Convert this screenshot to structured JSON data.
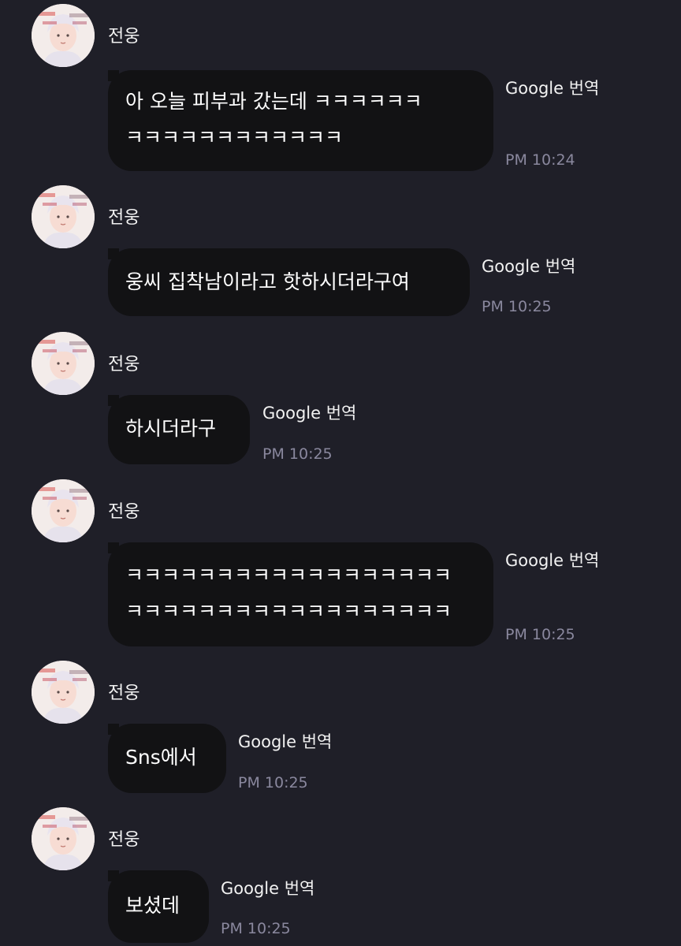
{
  "accent_colors": {
    "background": "#1f1f28",
    "bubble": "#121214",
    "timestamp": "#8a889e"
  },
  "messages": [
    {
      "sender": "전웅",
      "lines": [
        "아 오늘 피부과 갔는데 ㅋㅋㅋㅋㅋㅋ",
        "ㅋㅋㅋㅋㅋㅋㅋㅋㅋㅋㅋㅋ"
      ],
      "translate_label": "Google 번역",
      "time": "PM 10:24"
    },
    {
      "sender": "전웅",
      "lines": [
        "웅씨 집착남이라고 핫하시더라구여"
      ],
      "translate_label": "Google 번역",
      "time": "PM 10:25"
    },
    {
      "sender": "전웅",
      "lines": [
        "하시더라구"
      ],
      "translate_label": "Google 번역",
      "time": "PM 10:25"
    },
    {
      "sender": "전웅",
      "lines": [
        "ㅋㅋㅋㅋㅋㅋㅋㅋㅋㅋㅋㅋㅋㅋㅋㅋㅋㅋ",
        "ㅋㅋㅋㅋㅋㅋㅋㅋㅋㅋㅋㅋㅋㅋㅋㅋㅋㅋ"
      ],
      "translate_label": "Google 번역",
      "time": "PM 10:25"
    },
    {
      "sender": "전웅",
      "lines": [
        "Sns에서"
      ],
      "translate_label": "Google 번역",
      "time": "PM 10:25"
    },
    {
      "sender": "전웅",
      "lines": [
        "보셨데"
      ],
      "translate_label": "Google 번역",
      "time": "PM 10:25"
    }
  ]
}
